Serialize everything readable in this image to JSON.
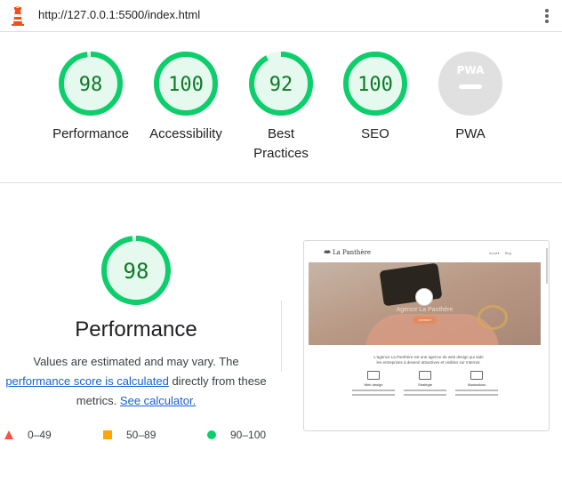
{
  "browser": {
    "url": "http://127.0.0.1:5500/index.html"
  },
  "colors": {
    "pass_green": "#0cce6b",
    "pass_fill": "#e6f9ef",
    "pass_text": "#0b7a26",
    "average_orange": "#ffa400",
    "fail_red": "#ff4e42",
    "pwa_gray": "#e0e0e0",
    "link_blue": "#1a5fd8"
  },
  "categories": [
    {
      "label": "Performance",
      "score": "98",
      "value": 98
    },
    {
      "label": "Accessibility",
      "score": "100",
      "value": 100
    },
    {
      "label": "Best Practices",
      "score": "92",
      "value": 92
    },
    {
      "label": "SEO",
      "score": "100",
      "value": 100
    },
    {
      "label": "PWA",
      "score": "",
      "value": null,
      "icon": "pwa-badge-icon",
      "badge_text": "PWA"
    }
  ],
  "performance": {
    "score": "98",
    "value": 98,
    "title": "Performance",
    "desc_pre": "Values are estimated and may vary. The ",
    "link_score": "performance score is calculated",
    "desc_mid": " directly from these metrics. ",
    "link_calc": "See calculator."
  },
  "legend": [
    {
      "range": "0–49",
      "icon": "triangle-fail-icon",
      "color": "#ff4e42"
    },
    {
      "range": "50–89",
      "icon": "square-average-icon",
      "color": "#ffa400"
    },
    {
      "range": "90–100",
      "icon": "circle-pass-icon",
      "color": "#0cce6b"
    }
  ],
  "thumbnail": {
    "brand": "La Panthère",
    "nav_links": [
      "Accueil",
      "Blog"
    ],
    "hero_title": "Agence La Panthère",
    "hero_button": "CONTACT",
    "intro_line1": "L'agence La Panthère est une agence de web design qui aide",
    "intro_line2": "les entreprises à devenir attractives et visibles sur Internet.",
    "services": [
      "Web design",
      "Stratégie",
      "Illustrations"
    ]
  }
}
